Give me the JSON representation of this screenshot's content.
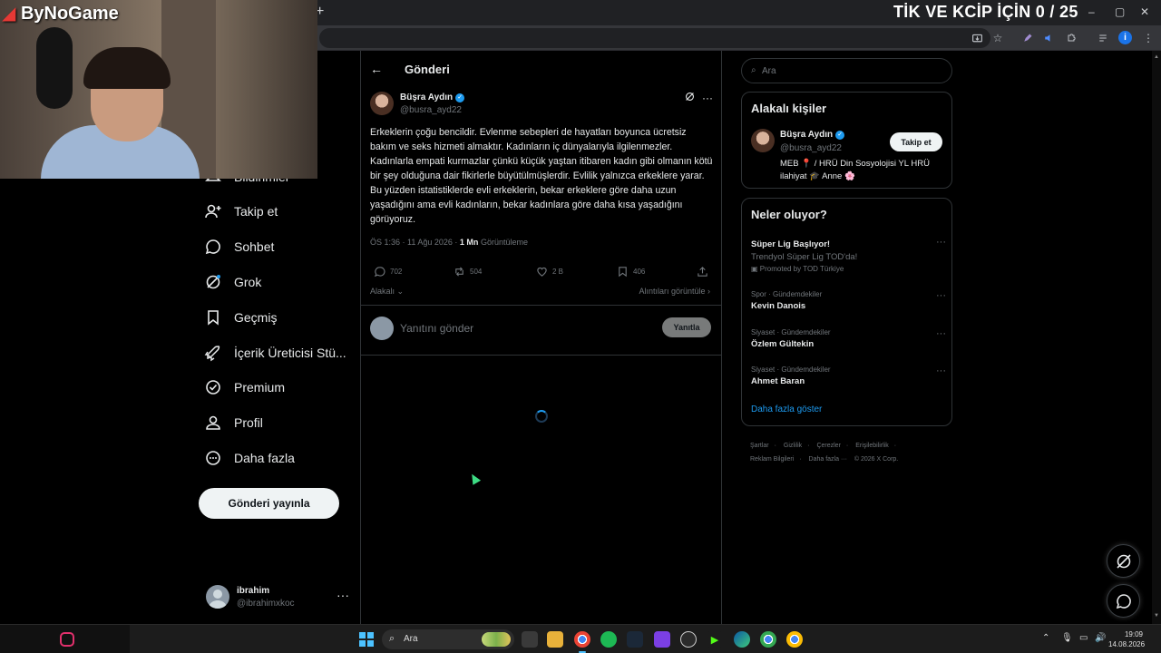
{
  "stream": {
    "title": "TİK VE KCİP İÇİN 0 / 25",
    "webcam_logo": "ByNoGame"
  },
  "browser": {
    "new_tab": "+",
    "window_controls": [
      "–",
      "▢",
      "✕"
    ],
    "profile_initial": "i"
  },
  "nav": {
    "items": [
      {
        "label": "Bildirimler",
        "icon": "bell-icon"
      },
      {
        "label": "Takip et",
        "icon": "follow-icon"
      },
      {
        "label": "Sohbet",
        "icon": "chat-icon"
      },
      {
        "label": "Grok",
        "icon": "grok-icon"
      },
      {
        "label": "Geçmiş",
        "icon": "bookmark-icon"
      },
      {
        "label": "İçerik Üreticisi Stü...",
        "icon": "rocket-icon"
      },
      {
        "label": "Premium",
        "icon": "premium-icon"
      },
      {
        "label": "Profil",
        "icon": "profile-icon"
      },
      {
        "label": "Daha fazla",
        "icon": "more-icon"
      }
    ],
    "post_button": "Gönderi yayınla",
    "account": {
      "name": "ibrahim",
      "handle": "@ibrahimxkoc",
      "more": "···"
    }
  },
  "post": {
    "header_title": "Gönderi",
    "back": "←",
    "author_name": "Büşra Aydın",
    "author_handle": "@busra_ayd22",
    "text": "Erkeklerin çoğu bencildir. Evlenme sebepleri de hayatları boyunca ücretsiz bakım ve seks hizmeti almaktır. Kadınların iç dünyalarıyla ilgilenmezler. Kadınlarla empati kurmazlar çünkü küçük yaştan itibaren kadın gibi olmanın kötü bir şey olduğuna dair fikirlerle büyütülmüşlerdir. Evlilik yalnızca erkeklere yarar. Bu yüzden istatistiklerde evli erkeklerin, bekar erkeklere göre daha uzun yaşadığını ama evli kadınların, bekar kadınlara göre daha kısa yaşadığını görüyoruz.",
    "time": "ÖS 1:36 · 11 Ağu 2026 ·",
    "views": "1 Mn",
    "views_label": "Görüntüleme",
    "replies": "702",
    "reposts": "504",
    "likes": "2 B",
    "bookmarks": "406",
    "relevant": "Alakalı",
    "quotes_link": "Alıntıları görüntüle",
    "reply_placeholder": "Yanıtını gönder",
    "reply_button": "Yanıtla"
  },
  "sidebar": {
    "search_placeholder": "Ara",
    "relevant_people": {
      "title": "Alakalı kişiler",
      "name": "Büşra Aydın",
      "handle": "@busra_ayd22",
      "follow": "Takip et",
      "bio": "MEB 📍 / HRÜ Din Sosyolojisi YL HRÜ ilahiyat 🎓 Anne 🌸"
    },
    "whats_happening": {
      "title": "Neler oluyor?",
      "trends": [
        {
          "category": "",
          "name": "Süper Lig Başlıyor!",
          "sub": "Trendyol Süper Lig TOD'da!",
          "promo": "Promoted by TOD Türkiye"
        },
        {
          "category": "Spor · Gündemdekiler",
          "name": "Kevin Danois",
          "sub": "",
          "promo": ""
        },
        {
          "category": "Siyaset · Gündemdekiler",
          "name": "Özlem Gültekin",
          "sub": "",
          "promo": ""
        },
        {
          "category": "Siyaset · Gündemdekiler",
          "name": "Ahmet Baran",
          "sub": "",
          "promo": ""
        }
      ],
      "show_more": "Daha fazla göster"
    },
    "footer": [
      "Şartlar",
      "·",
      "Gizlilik",
      "·",
      "Çerezler",
      "·",
      "Erişilebilirlik",
      "·",
      "Reklam Bilgileri",
      "·",
      "Daha fazla ···",
      "© 2026 X Corp."
    ]
  },
  "taskbar": {
    "search_label": "Ara",
    "time": "19:09",
    "date": "14.08.2026"
  },
  "colors": {
    "accent": "#1d9bf0",
    "background": "#000000",
    "border": "#2f3336",
    "muted": "#71767b"
  }
}
